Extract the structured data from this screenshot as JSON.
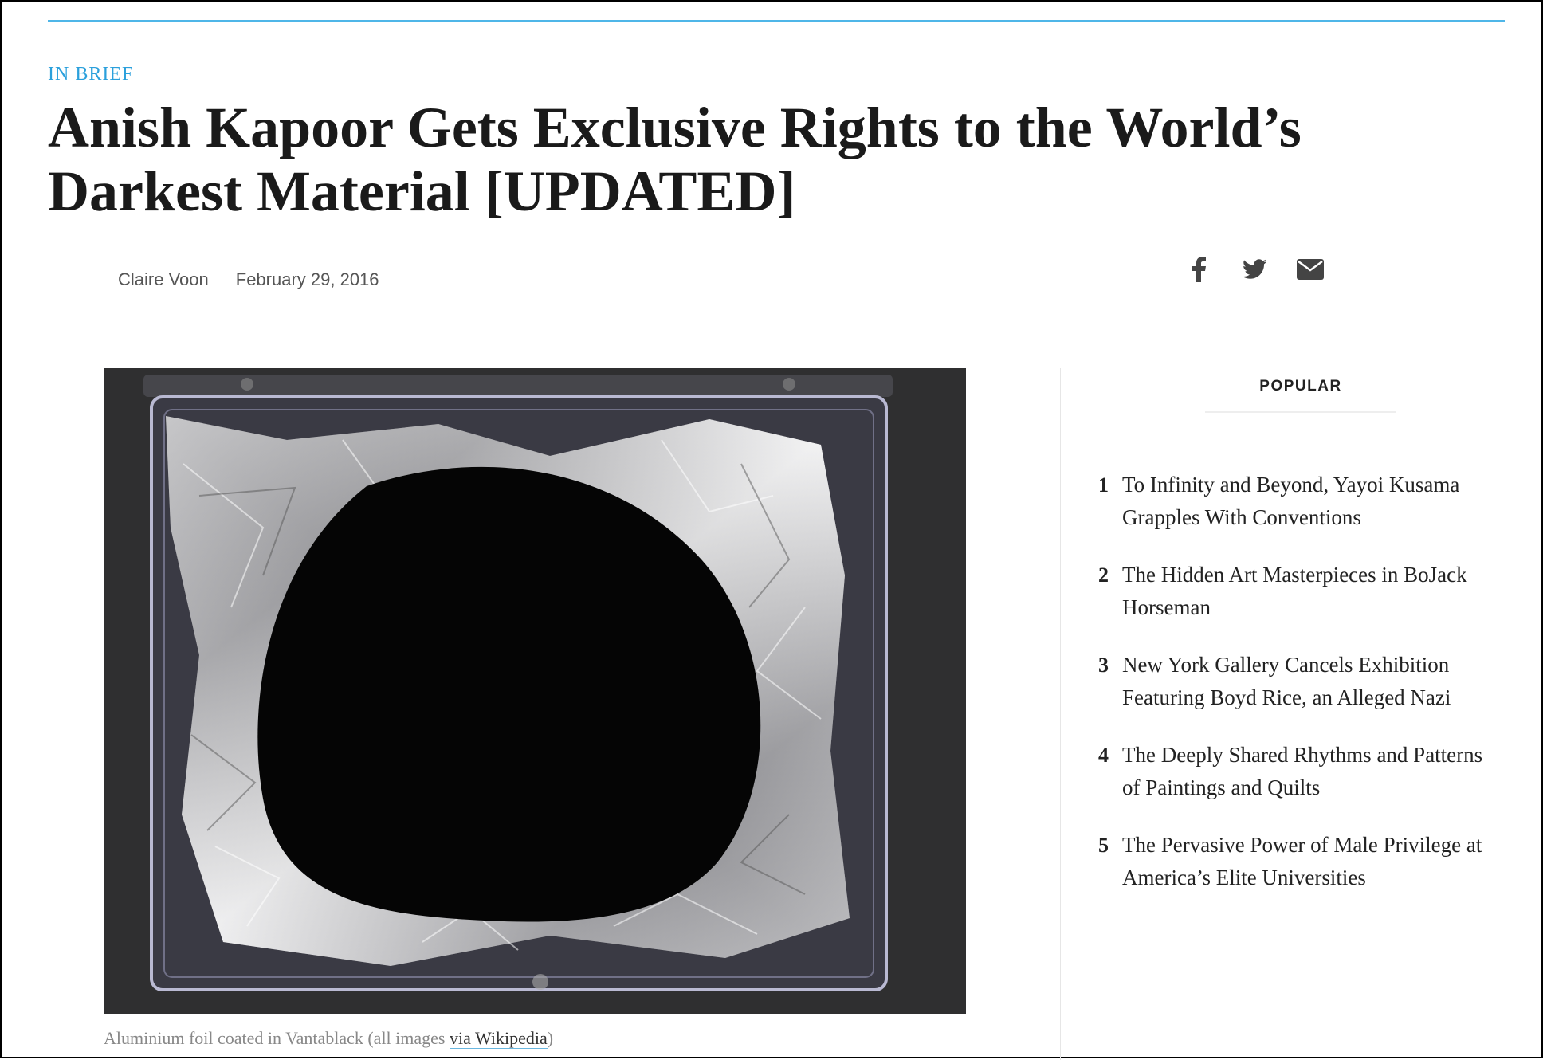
{
  "article": {
    "kicker": "IN BRIEF",
    "headline": "Anish Kapoor Gets Exclusive Rights to the World’s Darkest Material [UPDATED]",
    "author": "Claire Voon",
    "date": "February 29, 2016",
    "caption_prefix": "Aluminium foil coated in Vantablack (all images ",
    "caption_link": "via Wikipedia",
    "caption_suffix": ")"
  },
  "share": {
    "icons": [
      "facebook-icon",
      "twitter-icon",
      "email-icon"
    ]
  },
  "popular": {
    "title": "POPULAR",
    "items": [
      {
        "num": "1",
        "title": "To Infinity and Beyond, Yayoi Kusama Grapples With Conventions"
      },
      {
        "num": "2",
        "title": "The Hidden Art Masterpieces in BoJack Horseman"
      },
      {
        "num": "3",
        "title": "New York Gallery Cancels Exhibition Featuring Boyd Rice, an Alleged Nazi"
      },
      {
        "num": "4",
        "title": "The Deeply Shared Rhythms and Patterns of Paintings and Quilts"
      },
      {
        "num": "5",
        "title": "The Pervasive Power of Male Privilege at America’s Elite Universities"
      }
    ]
  },
  "colors": {
    "accent": "#2ba0dc",
    "rule": "#4fb6e8"
  }
}
